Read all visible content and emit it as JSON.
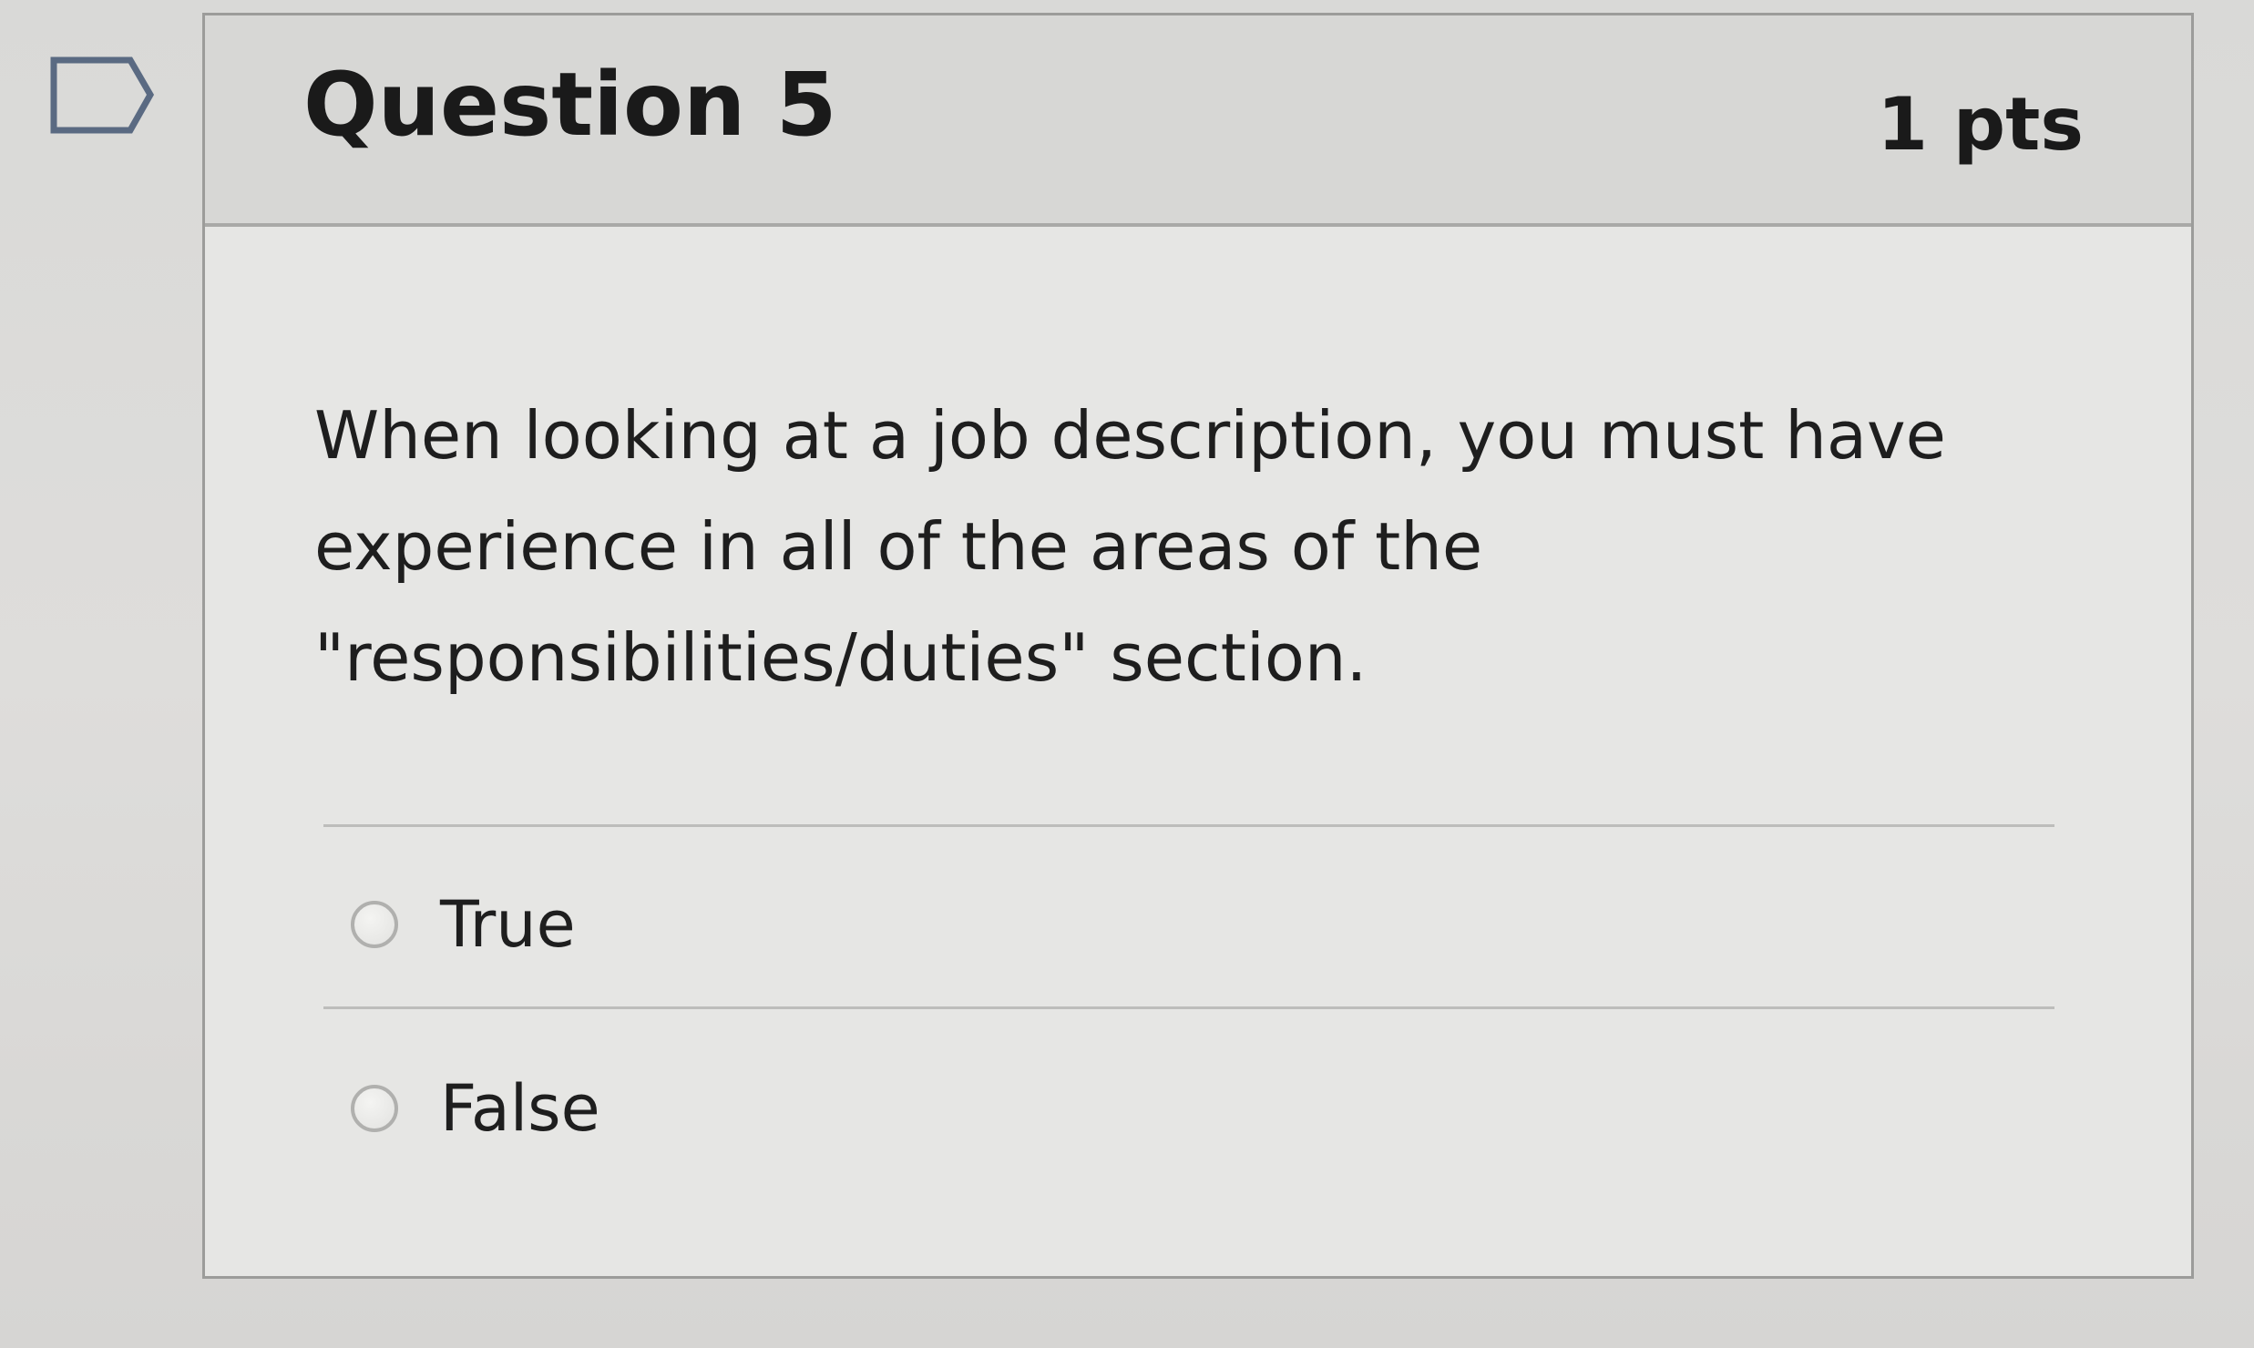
{
  "question": {
    "title": "Question 5",
    "points": "1 pts",
    "text": "When looking at a job description, you must have\nexperience in all of the areas of the\n\"responsibilities/duties\" section.",
    "flag_icon": "flag-outline-icon"
  },
  "answers": [
    {
      "label": "True",
      "selected": false
    },
    {
      "label": "False",
      "selected": false
    }
  ],
  "colors": {
    "header_bg": "#d7d7d5",
    "card_bg": "#e6e6e4",
    "border": "#9c9c9a"
  }
}
